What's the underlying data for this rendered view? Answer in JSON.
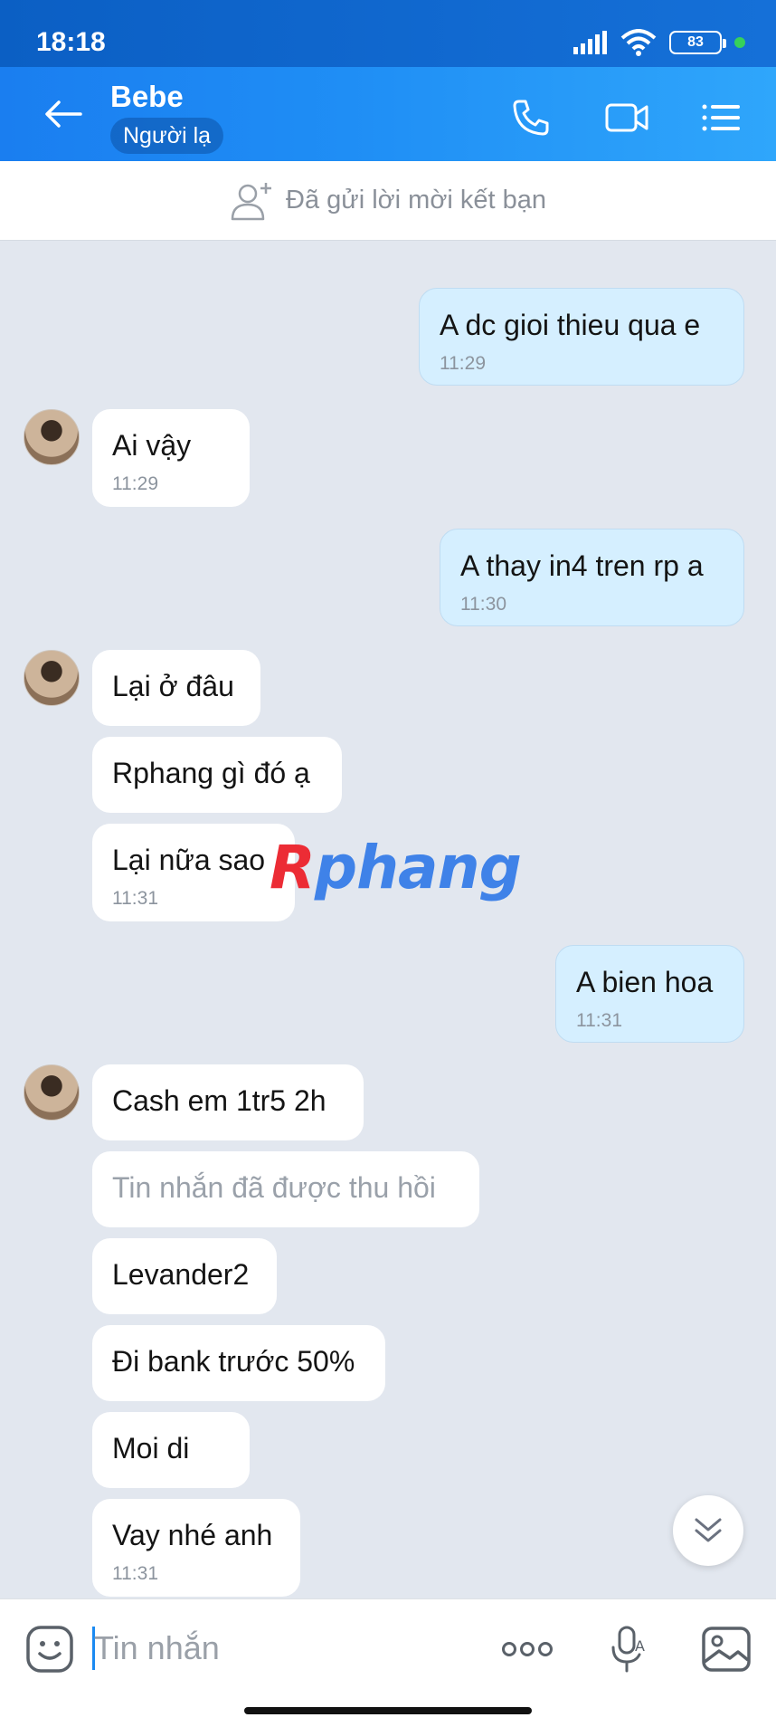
{
  "status_bar": {
    "time": "18:18",
    "battery": "83"
  },
  "header": {
    "title": "Bebe",
    "badge": "Người lạ"
  },
  "friend_request": {
    "text": "Đã gửi lời mời kết bạn"
  },
  "messages": [
    {
      "side": "out",
      "text": "A dc gioi thieu qua e",
      "time": "11:29"
    },
    {
      "side": "in",
      "text": "Ai vậy",
      "time": "11:29"
    },
    {
      "side": "out",
      "text": "A thay in4 tren rp a",
      "time": "11:30"
    },
    {
      "side": "in",
      "text": "Lại ở đâu",
      "time": ""
    },
    {
      "side": "in",
      "text": "Rphang gì đó ạ",
      "time": ""
    },
    {
      "side": "in",
      "text": "Lại nữa sao",
      "time": "11:31"
    },
    {
      "side": "out",
      "text": "A bien hoa",
      "time": "11:31"
    },
    {
      "side": "in",
      "text": "Cash em 1tr5 2h",
      "time": ""
    },
    {
      "side": "in",
      "text": "Tin nhắn đã được thu hồi",
      "time": ""
    },
    {
      "side": "in",
      "text": "Levander2",
      "time": ""
    },
    {
      "side": "in",
      "text": "Đi bank trước 50%",
      "time": ""
    },
    {
      "side": "in",
      "text": "Moi di",
      "time": ""
    },
    {
      "side": "in",
      "text": "Vay nhé anh",
      "time": "11:31"
    }
  ],
  "watermark": {
    "first": "R",
    "rest": "phang"
  },
  "composer": {
    "placeholder": "Tin nhắn"
  },
  "colors": {
    "accent": "#1a8af2",
    "outgoing_bubble": "#d5efff",
    "incoming_bubble": "#ffffff",
    "background": "#e2e7ef"
  }
}
